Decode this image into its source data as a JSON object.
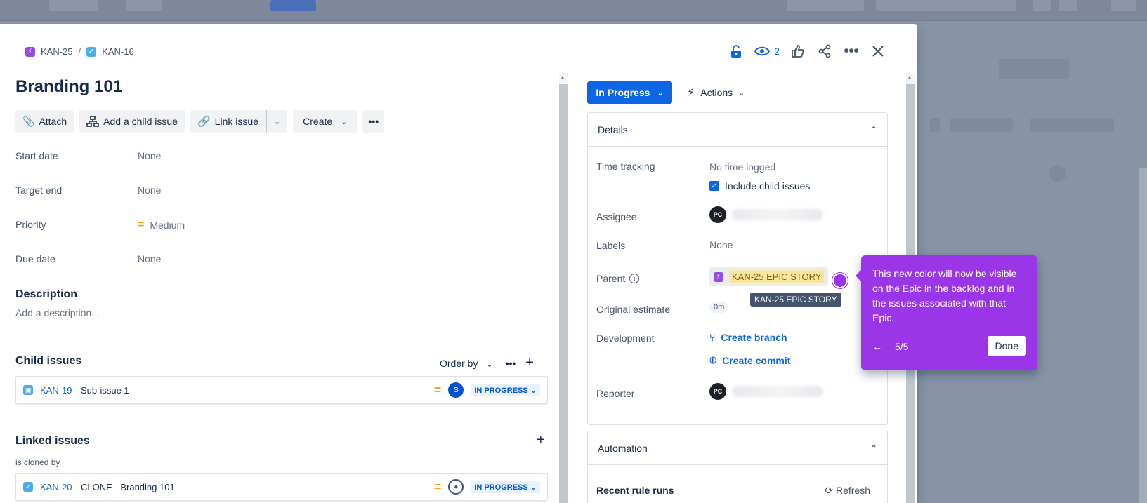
{
  "breadcrumb": {
    "parent_key": "KAN-25",
    "separator": "/",
    "current_key": "KAN-16"
  },
  "header": {
    "watch_count": "2"
  },
  "issue": {
    "title": "Branding 101"
  },
  "toolbar": {
    "attach": "Attach",
    "add_child": "Add a child issue",
    "link_issue": "Link issue",
    "create": "Create"
  },
  "fields": [
    {
      "label": "Start date",
      "value": "None"
    },
    {
      "label": "Target end",
      "value": "None"
    },
    {
      "label": "Priority",
      "value": "Medium"
    },
    {
      "label": "Due date",
      "value": "None"
    }
  ],
  "description": {
    "heading": "Description",
    "placeholder": "Add a description..."
  },
  "child_issues": {
    "heading": "Child issues",
    "order_by": "Order by",
    "items": [
      {
        "key": "KAN-19",
        "summary": "Sub-issue 1",
        "avatar": "S",
        "status": "IN PROGRESS"
      }
    ]
  },
  "linked_issues": {
    "heading": "Linked issues",
    "relation": "is cloned by",
    "items": [
      {
        "key": "KAN-20",
        "summary": "CLONE - Branding 101",
        "status": "IN PROGRESS"
      }
    ]
  },
  "right": {
    "status_label": "In Progress",
    "actions_label": "Actions",
    "details": {
      "heading": "Details",
      "time_tracking_label": "Time tracking",
      "time_tracking_value": "No time logged",
      "include_child": "Include child issues",
      "assignee_label": "Assignee",
      "assignee_initials": "PC",
      "labels_label": "Labels",
      "labels_value": "None",
      "parent_label": "Parent",
      "parent_value": "KAN-25 EPIC STORY",
      "parent_tooltip": "KAN-25 EPIC STORY",
      "estimate_label": "Original estimate",
      "estimate_value": "0m",
      "development_label": "Development",
      "create_branch": "Create branch",
      "create_commit": "Create commit",
      "reporter_label": "Reporter",
      "reporter_initials": "PC"
    },
    "automation": {
      "heading": "Automation",
      "recent_runs": "Recent rule runs",
      "refresh": "Refresh"
    }
  },
  "popover": {
    "text": "This new color will now be visible on the Epic in the backlog and in the issues associated with that Epic.",
    "step": "5/5",
    "done": "Done"
  },
  "colors": {
    "primary": "#0C66E4",
    "popover": "#9B36E8",
    "epic": "#904EE2",
    "task": "#4BADE8",
    "priority_medium": "#F5A623"
  }
}
